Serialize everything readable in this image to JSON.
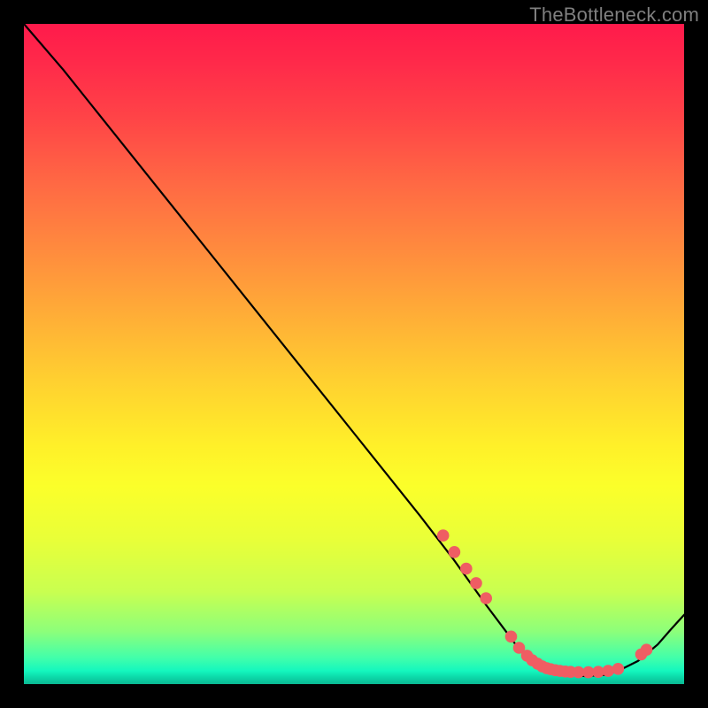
{
  "attribution": "TheBottleneck.com",
  "chart_data": {
    "type": "line",
    "title": "",
    "xlabel": "",
    "ylabel": "",
    "xlim": [
      0,
      100
    ],
    "ylim": [
      0,
      100
    ],
    "note": "Values estimated from pixel positions; no axis ticks present.",
    "series": [
      {
        "name": "curve",
        "x": [
          0,
          6,
          10,
          20,
          30,
          40,
          50,
          60,
          65,
          70,
          73,
          75,
          78,
          80,
          83,
          85,
          88,
          90,
          93,
          96,
          98,
          100
        ],
        "y": [
          100,
          93,
          88,
          75.5,
          63,
          50.5,
          38,
          25.5,
          19,
          12,
          8,
          5.3,
          3,
          2,
          1.4,
          1.2,
          1.4,
          2,
          3.5,
          6,
          8.3,
          10.5
        ]
      }
    ],
    "highlight_points": {
      "name": "dots",
      "x": [
        63.5,
        65.2,
        67,
        68.5,
        70,
        73.8,
        75,
        76.2,
        77,
        77.8,
        78.5,
        79.2,
        79.8,
        80.5,
        81.2,
        82,
        82.8,
        84,
        85.5,
        87,
        88.5,
        90,
        93.5,
        94.3
      ],
      "y": [
        22.5,
        20,
        17.5,
        15.3,
        13,
        7.2,
        5.5,
        4.3,
        3.6,
        3.1,
        2.7,
        2.4,
        2.25,
        2.1,
        2.0,
        1.9,
        1.85,
        1.8,
        1.8,
        1.85,
        2.0,
        2.3,
        4.5,
        5.2
      ]
    },
    "background_gradient": {
      "stops": [
        {
          "pct": 0,
          "color": "#ff1a4b"
        },
        {
          "pct": 24,
          "color": "#ff6844"
        },
        {
          "pct": 54,
          "color": "#ffd030"
        },
        {
          "pct": 70,
          "color": "#fbff2a"
        },
        {
          "pct": 92,
          "color": "#8dff7a"
        },
        {
          "pct": 100,
          "color": "#0ab893"
        }
      ]
    }
  }
}
